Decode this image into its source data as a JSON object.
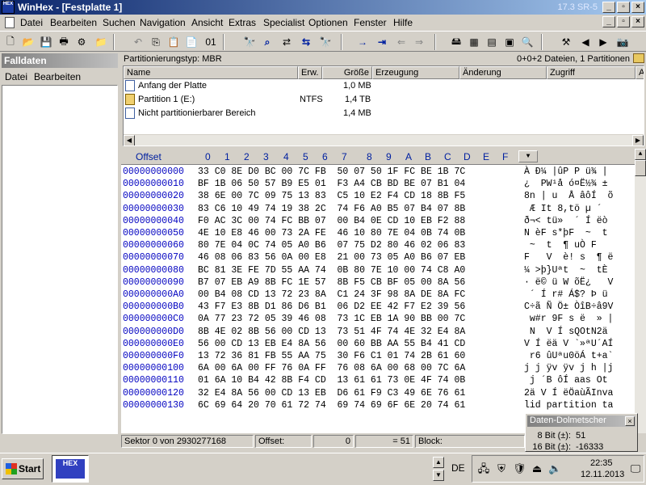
{
  "window": {
    "title": "WinHex - [Festplatte 1]",
    "version": "17.3 SR-5",
    "icon_text": "HEX"
  },
  "menu": [
    "Datei",
    "Bearbeiten",
    "Suchen",
    "Navigation",
    "Ansicht",
    "Extras",
    "Specialist",
    "Optionen",
    "Fenster",
    "Hilfe"
  ],
  "left_panel": {
    "title": "Falldaten",
    "menu": [
      "Datei",
      "Bearbeiten"
    ]
  },
  "partition_bar": {
    "type": "Partitionierungstyp: MBR",
    "summary": "0+0+2 Dateien, 1 Partitionen"
  },
  "file_table": {
    "columns": [
      "Name",
      "Erw.",
      "Größe",
      "Erzeugung",
      "Änderung",
      "Zugriff",
      "At"
    ],
    "rows": [
      {
        "name": "Anfang der Platte",
        "ext": "",
        "size": "1,0 MB"
      },
      {
        "name": "Partition 1 (E:)",
        "ext": "NTFS",
        "size": "1,4 TB"
      },
      {
        "name": "Nicht partitionierbarer Bereich",
        "ext": "",
        "size": "1,4 MB"
      }
    ]
  },
  "hex_view": {
    "offset_label": "Offset",
    "columns": [
      "0",
      "1",
      "2",
      "3",
      "4",
      "5",
      "6",
      "7",
      "8",
      "9",
      "A",
      "B",
      "C",
      "D",
      "E",
      "F"
    ],
    "rows": [
      {
        "offset": "00000000000",
        "bytes": "33 C0 8E D0 BC 00 7C FB  50 07 50 1F FC BE 1B 7C",
        "text": "À Ð¼ |ûP P ü¾ |"
      },
      {
        "offset": "00000000010",
        "bytes": "BF 1B 06 50 57 B9 E5 01  F3 A4 CB BD BE 07 B1 04",
        "text": "¿  PW¹å ó¤Ë½¾ ±"
      },
      {
        "offset": "00000000020",
        "bytes": "38 6E 00 7C 09 75 13 83  C5 10 E2 F4 CD 18 8B F5",
        "text": "8n | u  Å âôÍ  õ"
      },
      {
        "offset": "00000000030",
        "bytes": "83 C6 10 49 74 19 38 2C  74 F6 A0 B5 07 B4 07 8B",
        "text": " Æ It 8,tö µ ´"
      },
      {
        "offset": "00000000040",
        "bytes": "F0 AC 3C 00 74 FC BB 07  00 B4 0E CD 10 EB F2 88",
        "text": "ð¬< tü»  ´ Í ëò"
      },
      {
        "offset": "00000000050",
        "bytes": "4E 10 E8 46 00 73 2A FE  46 10 80 7E 04 0B 74 0B",
        "text": "N èF s*þF  ~  t"
      },
      {
        "offset": "00000000060",
        "bytes": "80 7E 04 0C 74 05 A0 B6  07 75 D2 80 46 02 06 83",
        "text": " ~  t  ¶ uÒ F"
      },
      {
        "offset": "00000000070",
        "bytes": "46 08 06 83 56 0A 00 E8  21 00 73 05 A0 B6 07 EB",
        "text": "F   V  è! s  ¶ ë"
      },
      {
        "offset": "00000000080",
        "bytes": "BC 81 3E FE 7D 55 AA 74  0B 80 7E 10 00 74 C8 A0",
        "text": "¼ >þ}Uªt  ~  tÈ"
      },
      {
        "offset": "00000000090",
        "bytes": "B7 07 EB A9 8B FC 1E 57  8B F5 CB BF 05 00 8A 56",
        "text": "· ë© ü W õË¿   V"
      },
      {
        "offset": "000000000A0",
        "bytes": "00 B4 08 CD 13 72 23 8A  C1 24 3F 98 8A DE 8A FC",
        "text": " ´ Í r# Á$? Þ ü"
      },
      {
        "offset": "000000000B0",
        "bytes": "43 F7 E3 8B D1 86 D6 B1  06 D2 EE 42 F7 E2 39 56",
        "text": "C÷ã Ñ Ö± ÒîB÷â9V"
      },
      {
        "offset": "000000000C0",
        "bytes": "0A 77 23 72 05 39 46 08  73 1C EB 1A 90 BB 00 7C",
        "text": " w#r 9F s ë  » |"
      },
      {
        "offset": "000000000D0",
        "bytes": "8B 4E 02 8B 56 00 CD 13  73 51 4F 74 4E 32 E4 8A",
        "text": " N  V Í sQOtN2ä"
      },
      {
        "offset": "000000000E0",
        "bytes": "56 00 CD 13 EB E4 8A 56  00 60 BB AA 55 B4 41 CD",
        "text": "V Í ëä V `»ªU´AÍ"
      },
      {
        "offset": "000000000F0",
        "bytes": "13 72 36 81 FB 55 AA 75  30 F6 C1 01 74 2B 61 60",
        "text": " r6 ûUªu0öÁ t+a`"
      },
      {
        "offset": "00000000100",
        "bytes": "6A 00 6A 00 FF 76 0A FF  76 08 6A 00 68 00 7C 6A",
        "text": "j j ÿv ÿv j h |j"
      },
      {
        "offset": "00000000110",
        "bytes": "01 6A 10 B4 42 8B F4 CD  13 61 61 73 0E 4F 74 0B",
        "text": " j ´B ôÍ aas Ot"
      },
      {
        "offset": "00000000120",
        "bytes": "32 E4 8A 56 00 CD 13 EB  D6 61 F9 C3 49 6E 76 61",
        "text": "2ä V Í ëÖaùÃInva"
      },
      {
        "offset": "00000000130",
        "bytes": "6C 69 64 20 70 61 72 74  69 74 69 6F 6E 20 74 61",
        "text": "lid partition ta"
      }
    ]
  },
  "status_bar": {
    "sector": "Sektor 0 von 2930277168",
    "offset_label": "Offset:",
    "offset_value": "0",
    "value": "= 51",
    "block_label": "Block:"
  },
  "interpreter": {
    "title": "Daten-Dolmetscher",
    "rows": [
      {
        "label": "8 Bit (±):",
        "value": "51"
      },
      {
        "label": "16 Bit (±):",
        "value": "-16333"
      }
    ]
  },
  "taskbar": {
    "start": "Start",
    "language": "DE",
    "time": "22:35",
    "date": "12.11.2013",
    "task_logo": "HEX"
  },
  "colors": {
    "title_bar": "#0a246a",
    "offset_text": "#0000c0",
    "selection": "#000080",
    "chrome": "#d4d0c8"
  }
}
